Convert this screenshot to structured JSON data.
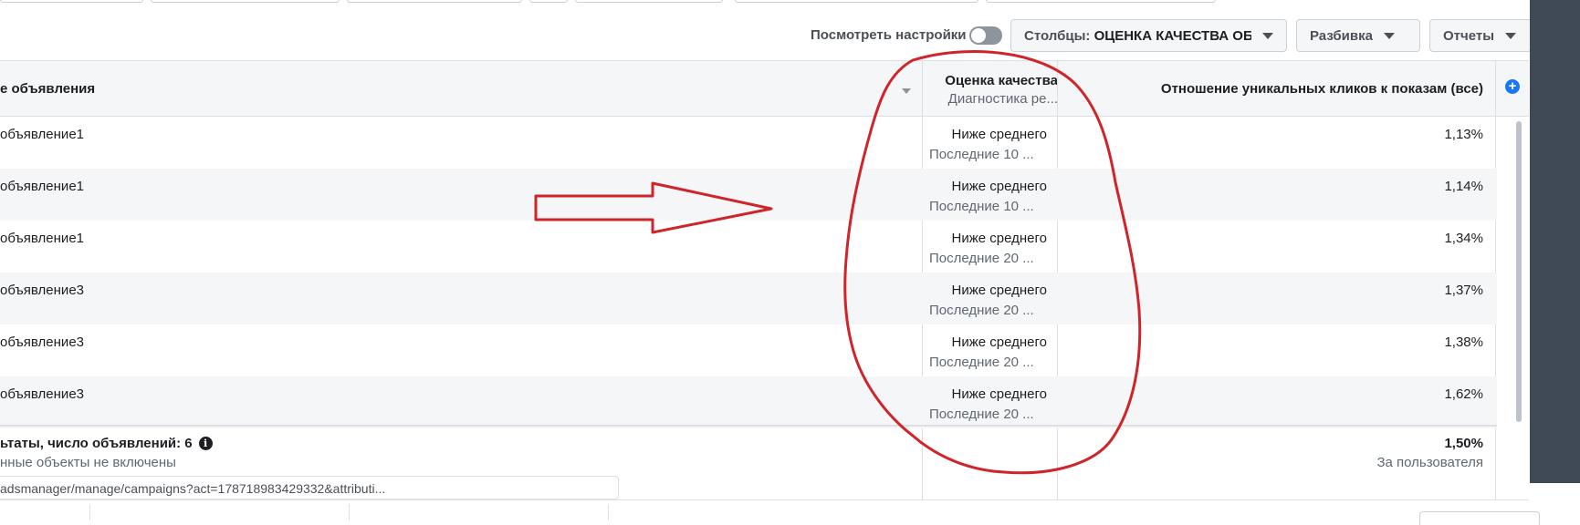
{
  "toolbar": {
    "view_settings_label": "Посмотреть настройки",
    "columns_prefix": "Столбцы:",
    "columns_value": "ОЦЕНКА КАЧЕСТВА ОБ",
    "breakdown_label": "Разбивка",
    "reports_label": "Отчеты"
  },
  "table": {
    "name_header": "е объявления",
    "quality_header": "Оценка качества",
    "quality_subheader": "Диагностика ре...",
    "ratio_header": "Отношение уникальных кликов к показам (все)",
    "rows": [
      {
        "name": "объявление1",
        "quality": "Ниже среднего",
        "quality_note": "Последние 10 ...",
        "ratio": "1,13%"
      },
      {
        "name": "объявление1",
        "quality": "Ниже среднего",
        "quality_note": "Последние 10 ...",
        "ratio": "1,14%"
      },
      {
        "name": "объявление1",
        "quality": "Ниже среднего",
        "quality_note": "Последние 20 ...",
        "ratio": "1,34%"
      },
      {
        "name": "объявление3",
        "quality": "Ниже среднего",
        "quality_note": "Последние 20 ...",
        "ratio": "1,37%"
      },
      {
        "name": "объявление3",
        "quality": "Ниже среднего",
        "quality_note": "Последние 20 ...",
        "ratio": "1,38%"
      },
      {
        "name": "объявление3",
        "quality": "Ниже среднего",
        "quality_note": "Последние 20 ...",
        "ratio": "1,62%"
      }
    ],
    "summary_label": "ьтаты, число объявлений: 6",
    "summary_note": "нные объекты не включены",
    "summary_value": "1,50%",
    "summary_value_note": "За пользователя"
  },
  "url_tooltip": "adsmanager/manage/campaigns?act=178718983429332&attributi...",
  "colors": {
    "annotation": "#d0242b",
    "accent": "#1877f2",
    "side_panel": "#3f4a56"
  },
  "icons": [
    "toggle-switch",
    "chevron-down-icon",
    "plus-circle-icon",
    "info-icon"
  ]
}
